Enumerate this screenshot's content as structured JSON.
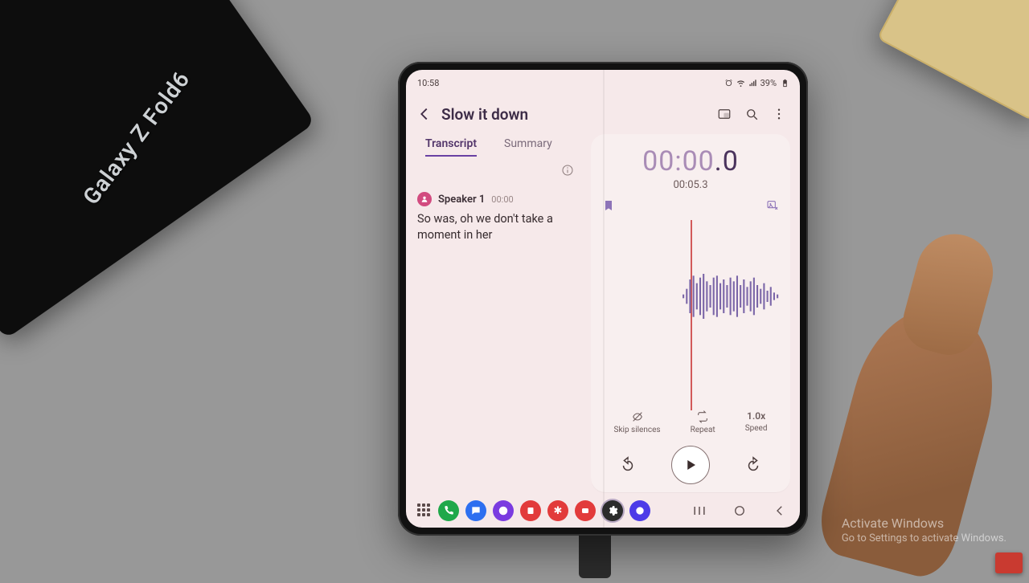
{
  "desk": {
    "box_label": "Galaxy Z Fold6"
  },
  "statusbar": {
    "time": "10:58",
    "battery": "39%"
  },
  "header": {
    "title": "Slow it down"
  },
  "tabs": {
    "transcript": "Transcript",
    "summary": "Summary"
  },
  "transcript": {
    "speaker": "Speaker 1",
    "timestamp": "00:00",
    "text": "So was, oh we don't take a moment in her"
  },
  "playback": {
    "current_time_dim": "00:00",
    "current_time_cur": ".0",
    "total_time": "00:05.3",
    "skip_silences_label": "Skip silences",
    "repeat_label": "Repeat",
    "speed_value": "1.0x",
    "speed_label": "Speed"
  },
  "watermark": {
    "line1": "Activate Windows",
    "line2": "Go to Settings to activate Windows."
  }
}
